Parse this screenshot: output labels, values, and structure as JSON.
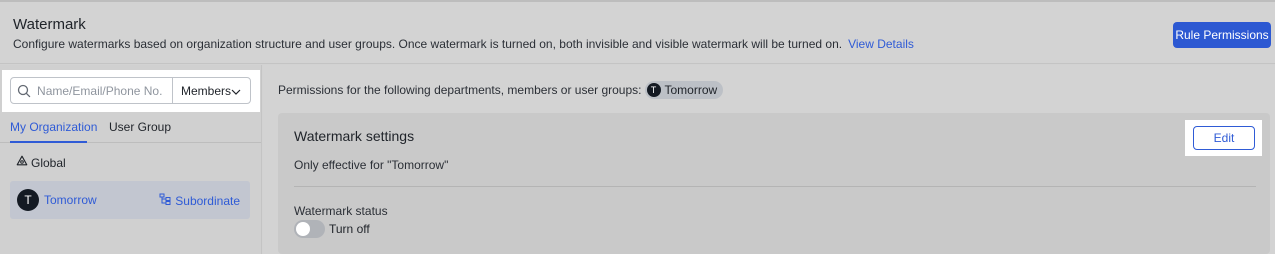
{
  "header": {
    "title": "Watermark",
    "description": "Configure watermarks based on organization structure and user groups. Once watermark is turned on, both invisible and visible watermark will be turned on.",
    "link_label": "View Details",
    "rule_permissions_label": "Rule Permissions"
  },
  "sidebar": {
    "search_placeholder": "Name/Email/Phone No.",
    "search_value": "",
    "scope_select": "Members",
    "tabs": [
      {
        "label": "My Organization",
        "active": true
      },
      {
        "label": "User Group",
        "active": false
      }
    ],
    "global_label": "Global",
    "selected_item": {
      "avatar_letter": "T",
      "name": "Tomorrow",
      "subordinate_label": "Subordinate"
    }
  },
  "main": {
    "permissions_text": "Permissions for the following departments, members or user groups:",
    "chip": {
      "avatar_letter": "T",
      "name": "Tomorrow"
    },
    "card": {
      "title": "Watermark settings",
      "effective_text": "Only effective for \"Tomorrow\"",
      "edit_label": "Edit",
      "status_label": "Watermark status",
      "toggle_label": "Turn off",
      "toggle_on": false
    }
  },
  "colors": {
    "accent": "#2f5bd6",
    "primary_button": "#2c58d2",
    "background": "#d3d3d3",
    "selected_item_bg": "#c2c6d0"
  }
}
